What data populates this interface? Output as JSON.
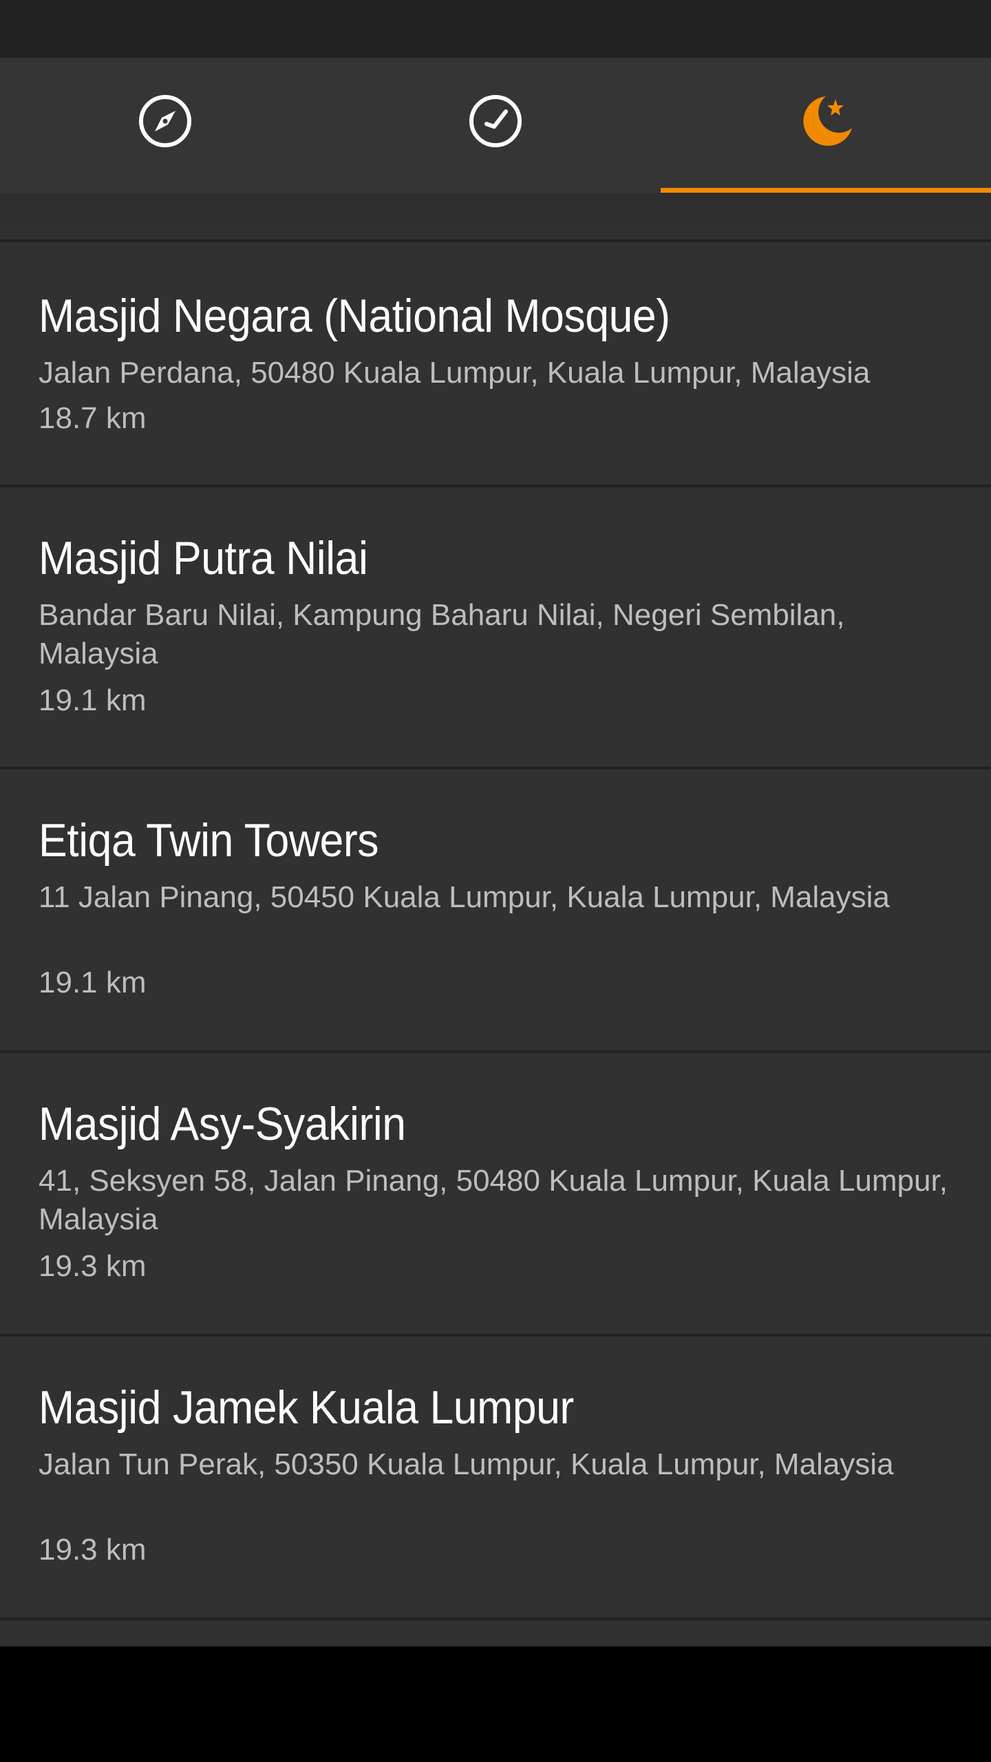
{
  "tabs": [
    {
      "icon": "compass-icon",
      "name": "qibla"
    },
    {
      "icon": "clock-icon",
      "name": "prayer-times"
    },
    {
      "icon": "crescent-star-icon",
      "name": "mosques",
      "active": true
    }
  ],
  "colors": {
    "accent": "#f28a00",
    "tab_bar": "#353535",
    "list_bg": "#313131",
    "title_text": "#ffffff",
    "secondary_text": "#bdbdbd"
  },
  "mosques": [
    {
      "name": "Masjid Negara (National Mosque)",
      "address": "Jalan Perdana, 50480 Kuala Lumpur, Kuala Lumpur, Malaysia",
      "distance": "18.7 km"
    },
    {
      "name": "Masjid Putra Nilai",
      "address": "Bandar Baru Nilai, Kampung Baharu Nilai, Negeri Sembilan, Malaysia",
      "distance": "19.1 km"
    },
    {
      "name": "Etiqa Twin Towers",
      "address": "11 Jalan Pinang, 50450 Kuala Lumpur, Kuala Lumpur, Malaysia",
      "distance": "19.1 km"
    },
    {
      "name": "Masjid Asy-Syakirin",
      "address": "41, Seksyen 58, Jalan Pinang, 50480 Kuala Lumpur, Kuala Lumpur, Malaysia",
      "distance": "19.3 km"
    },
    {
      "name": "Masjid Jamek Kuala Lumpur",
      "address": "Jalan Tun Perak, 50350 Kuala Lumpur, Kuala Lumpur, Malaysia",
      "distance": "19.3 km"
    }
  ]
}
